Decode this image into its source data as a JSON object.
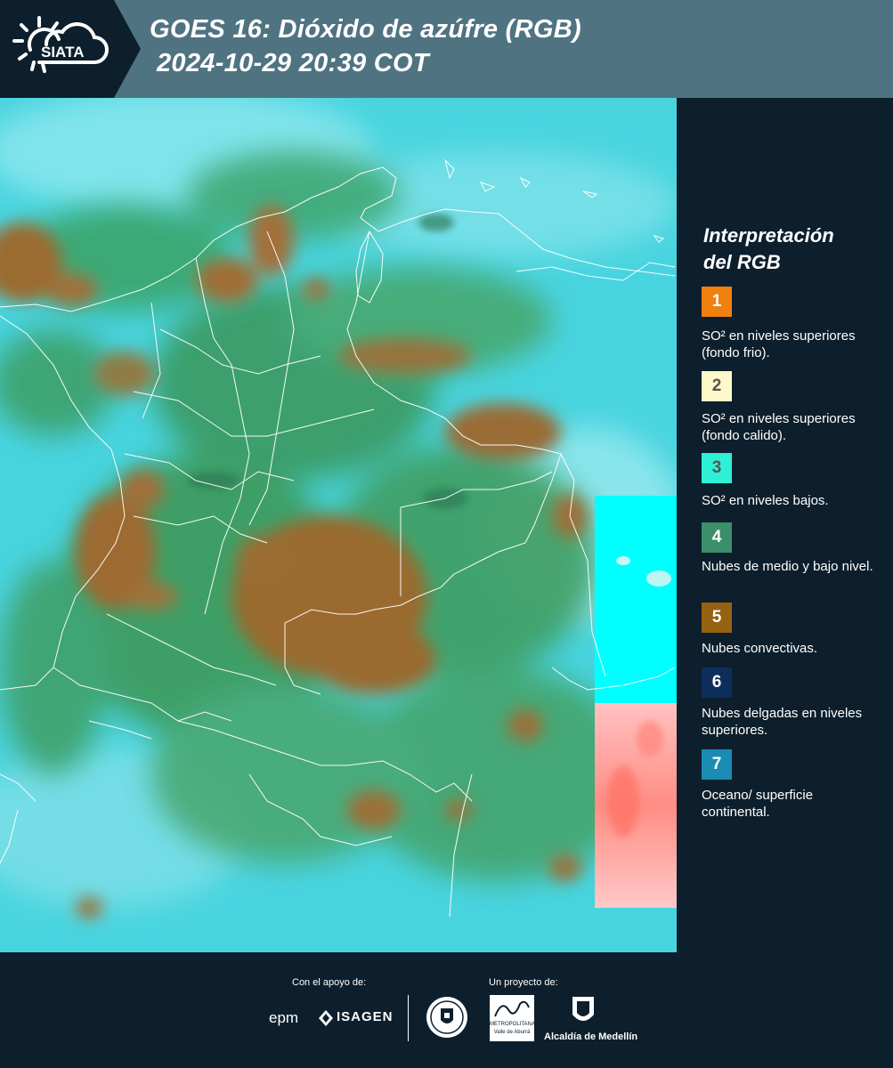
{
  "header": {
    "logo_text": "SIATA",
    "title_line1": "GOES 16: Dióxido de azúfre (RGB)",
    "title_line2": "2024-10-29 20:39 COT"
  },
  "legend": {
    "title_line1": "Interpretación",
    "title_line2": "del RGB",
    "items": [
      {
        "number": "1",
        "color": "#f08010",
        "label": "SO² en niveles superiores (fondo frio)."
      },
      {
        "number": "2",
        "color": "#fff8c8",
        "label": "SO² en niveles superiores (fondo calido)."
      },
      {
        "number": "3",
        "color": "#2ef0d6",
        "label": "SO² en niveles bajos."
      },
      {
        "number": "4",
        "color": "#3b8f6a",
        "label": "Nubes de medio y bajo nivel."
      },
      {
        "number": "5",
        "color": "#956212",
        "label": "Nubes convectivas."
      },
      {
        "number": "6",
        "color": "#0e2e5a",
        "label": "Nubes delgadas en niveles superiores."
      },
      {
        "number": "7",
        "color": "#1a8cb4",
        "label": "Oceano/ superficie continental."
      }
    ]
  },
  "footer": {
    "support_label": "Con el apoyo de:",
    "project_label": "Un proyecto de:",
    "sponsor1": "epm",
    "sponsor2": "ISAGEN",
    "partner1_line1": "METROPOLITANA",
    "partner1_line2": "Valle de Aburrá",
    "partner2": "Alcaldía de Medellín"
  },
  "colors": {
    "header_bg": "#4f7381",
    "dark_bg": "#0d1f2c",
    "ocean": "#44d4e0",
    "convective": "#9a6f2e",
    "low_cloud": "#3a9a66"
  }
}
